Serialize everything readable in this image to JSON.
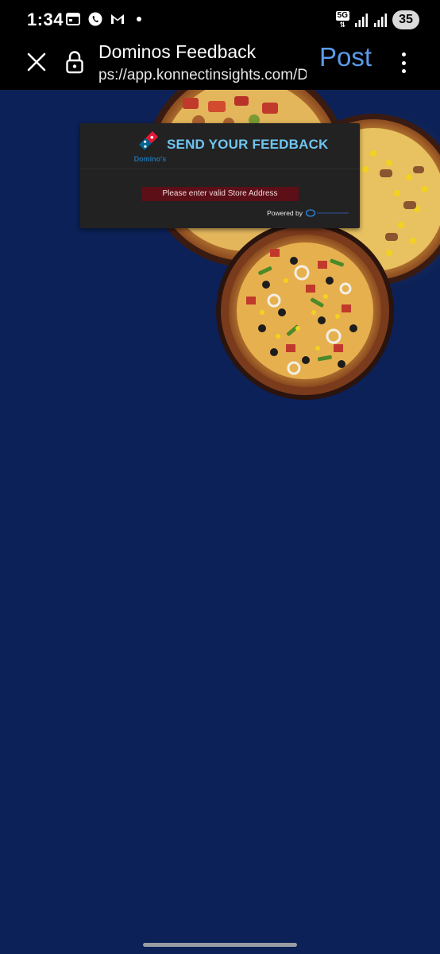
{
  "status_bar": {
    "time": "1:34",
    "network": "5G",
    "battery": "35",
    "icons": [
      "calendar-icon",
      "whatsapp-icon",
      "gmail-icon",
      "notification-dot",
      "signal-icon",
      "signal-icon",
      "battery-icon"
    ]
  },
  "toolbar": {
    "title": "Dominos Feedback",
    "url": "ps://app.konnectinsights.com/D",
    "action_label": "Post",
    "icons": [
      "close-icon",
      "lock-icon",
      "more-vert-icon"
    ]
  },
  "feedback": {
    "logo_text": "Domino's",
    "title": "SEND YOUR FEEDBACK",
    "error": "Please enter valid Store Address",
    "powered_by": "Powered by"
  },
  "colors": {
    "page_background": "#0b2157",
    "card_background": "#222222",
    "title_color": "#6fc4ef",
    "error_background": "#5c0f17",
    "post_color": "#5b9bea"
  }
}
